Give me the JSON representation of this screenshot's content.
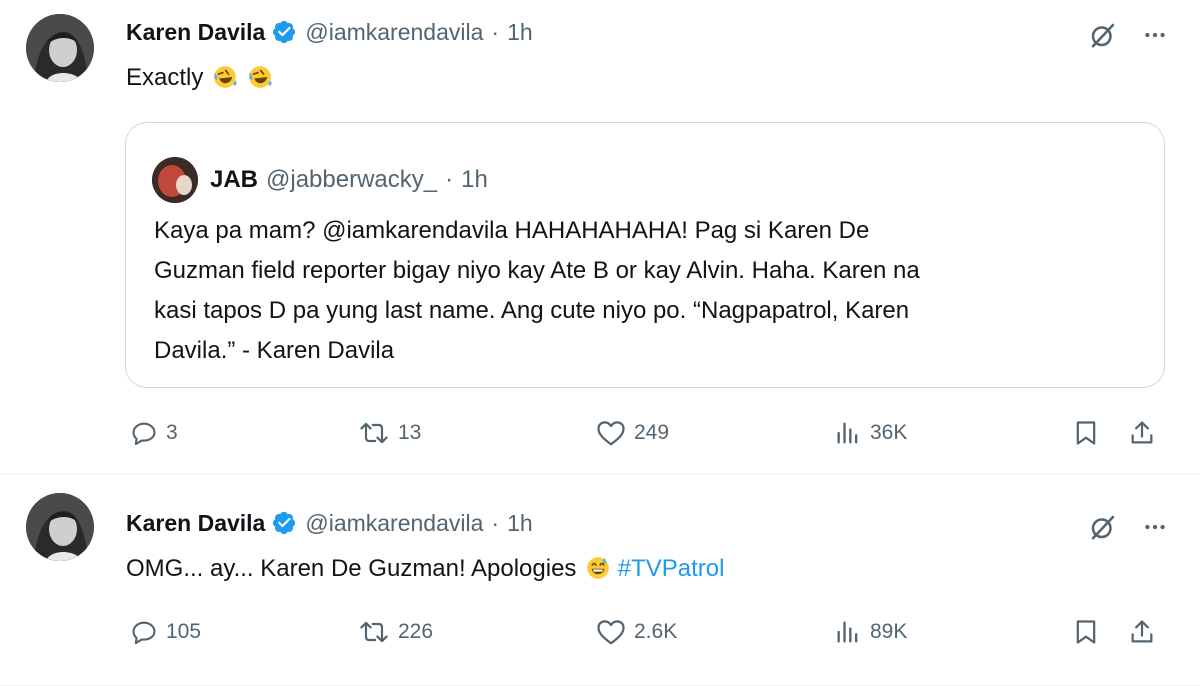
{
  "tweets": [
    {
      "author": {
        "name": "Karen Davila",
        "handle": "@iamkarendavila",
        "time": "1h",
        "verified": true
      },
      "text": "Exactly",
      "emojis": [
        "rolling-on-floor-laughing",
        "rolling-on-floor-laughing"
      ],
      "quote": {
        "author": {
          "name": "JAB",
          "handle": "@jabberwacky_",
          "time": "1h"
        },
        "lines": [
          "Kaya pa mam? @iamkarendavila HAHAHAHAHA! Pag si Karen De",
          "Guzman field reporter bigay niyo kay Ate B or kay Alvin. Haha. Karen na",
          "kasi tapos D pa yung last name. Ang cute niyo po. “Nagpapatrol, Karen",
          "Davila.” - Karen Davila"
        ]
      },
      "stats": {
        "replies": "3",
        "reposts": "13",
        "likes": "249",
        "views": "36K"
      }
    },
    {
      "author": {
        "name": "Karen Davila",
        "handle": "@iamkarendavila",
        "time": "1h",
        "verified": true
      },
      "text": "OMG... ay... Karen De Guzman! Apologies",
      "emojis": [
        "grinning-face-with-sweat"
      ],
      "hashtag": "#TVPatrol",
      "stats": {
        "replies": "105",
        "reposts": "226",
        "likes": "2.6K",
        "views": "89K"
      }
    }
  ],
  "separator": "·",
  "colors": {
    "accent": "#1d9bf0",
    "secondary_text": "#536471",
    "border": "#cfd9de",
    "verified": "#1d9bf0"
  }
}
